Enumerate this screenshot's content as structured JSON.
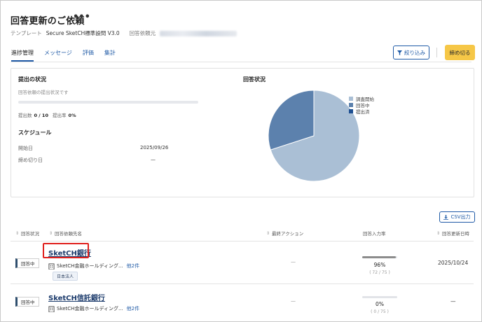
{
  "header": {
    "title": "回答更新のご依頼",
    "more": "•••",
    "template_label": "テンプレート",
    "template_value": "Secure SketCH標準設問 V3.0",
    "requester_label": "回答依頼元"
  },
  "tabs": [
    {
      "label": "進捗管理",
      "active": true
    },
    {
      "label": "メッセージ",
      "active": false
    },
    {
      "label": "評価",
      "active": false
    },
    {
      "label": "集計",
      "active": false
    }
  ],
  "toolbar": {
    "filter_label": "絞り込み",
    "filter_icon": "filter-icon",
    "close_label": "締め切る"
  },
  "submission": {
    "title": "提出の状況",
    "desc": "回答依頼の提出状況です",
    "progress_fraction": 0,
    "count_label": "提出数",
    "count_value": "0 / 10",
    "rate_label": "提出率",
    "rate_value": "0%"
  },
  "schedule": {
    "title": "スケジュール",
    "start_label": "開始日",
    "start_value": "2025/09/26",
    "deadline_label": "締め切り日",
    "deadline_value": "—"
  },
  "chart_data": {
    "type": "pie",
    "title": "回答状況",
    "categories": [
      "調査開始",
      "回答中",
      "提出済"
    ],
    "values": [
      7,
      3,
      0
    ],
    "colors": [
      "#aabfd5",
      "#5c81ad",
      "#1d4f91"
    ],
    "legend": "bottom-right"
  },
  "csv_button": {
    "label": "CSV出力",
    "icon": "download-icon"
  },
  "table": {
    "headers": [
      "回答状況",
      "回答依頼先名",
      "最終アクション",
      "回答入力率",
      "回答更新日時"
    ],
    "rows": [
      {
        "status": "回答中",
        "name": "SketCH銀行",
        "org": "SketCH金融ホールディング...",
        "more": "他2件",
        "tag": "日本法人",
        "last_action": "—",
        "progress_fraction": 0.96,
        "percent": "96%",
        "fraction": "( 72 / 75 )",
        "updated": "2025/10/24"
      },
      {
        "status": "回答中",
        "name": "SketCH信託銀行",
        "org": "SketCH金融ホールディング...",
        "more": "他2件",
        "tag": "",
        "last_action": "—",
        "progress_fraction": 0,
        "percent": "0%",
        "fraction": "( 0 / 75 )",
        "updated": "—"
      }
    ]
  }
}
